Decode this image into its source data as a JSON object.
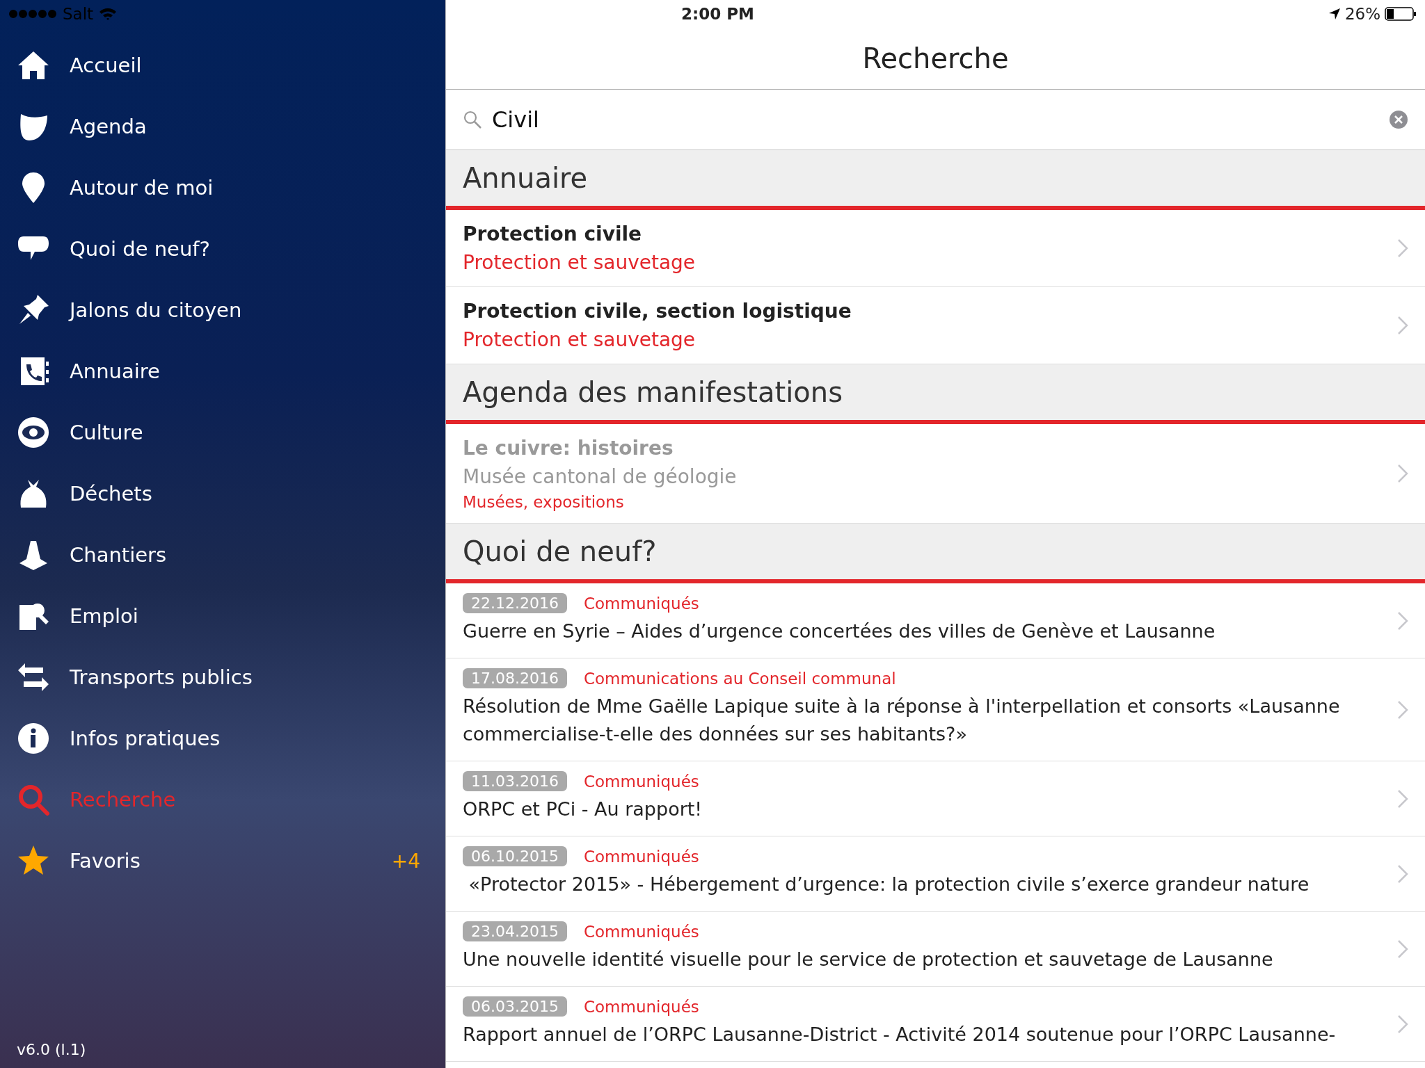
{
  "status_bar": {
    "carrier": "Salt",
    "time": "2:00 PM",
    "battery": "26%"
  },
  "sidebar": {
    "items": [
      {
        "label": "Accueil",
        "selected": false
      },
      {
        "label": "Agenda",
        "selected": false
      },
      {
        "label": "Autour de moi",
        "selected": false
      },
      {
        "label": "Quoi de neuf?",
        "selected": false
      },
      {
        "label": "Jalons du citoyen",
        "selected": false
      },
      {
        "label": "Annuaire",
        "selected": false
      },
      {
        "label": "Culture",
        "selected": false
      },
      {
        "label": "Déchets",
        "selected": false
      },
      {
        "label": "Chantiers",
        "selected": false
      },
      {
        "label": "Emploi",
        "selected": false
      },
      {
        "label": "Transports publics",
        "selected": false
      },
      {
        "label": "Infos pratiques",
        "selected": false
      },
      {
        "label": "Recherche",
        "selected": true
      },
      {
        "label": "Favoris",
        "selected": false,
        "badge": "+4"
      }
    ],
    "version": "v6.0 (l.1)"
  },
  "header": {
    "title": "Recherche"
  },
  "search": {
    "value": "Civil"
  },
  "sections": [
    {
      "title": "Annuaire",
      "kind": "directory",
      "items": [
        {
          "title": "Protection civile",
          "subtitle": "Protection et sauvetage"
        },
        {
          "title": "Protection civile, section logistique",
          "subtitle": "Protection et sauvetage"
        }
      ]
    },
    {
      "title": "Agenda des manifestations",
      "kind": "events",
      "items": [
        {
          "title": "Le cuivre: histoires",
          "subtitle": "Musée cantonal de géologie",
          "category": "Musées, expositions"
        }
      ]
    },
    {
      "title": "Quoi de neuf?",
      "kind": "news",
      "items": [
        {
          "date": "22.12.2016",
          "category": "Communiqués",
          "title": "Guerre en Syrie – Aides d’urgence concertées des villes de Genève et Lausanne"
        },
        {
          "date": "17.08.2016",
          "category": "Communications au Conseil communal",
          "title": "Résolution de Mme Gaëlle Lapique suite à la réponse à l'interpellation et consorts «Lausanne commercialise-t-elle des données sur ses habitants?»"
        },
        {
          "date": "11.03.2016",
          "category": "Communiqués",
          "title": "ORPC et PCi - Au rapport!"
        },
        {
          "date": "06.10.2015",
          "category": "Communiqués",
          "title": " «Protector 2015» - Hébergement d’urgence: la protection civile s’exerce grandeur nature"
        },
        {
          "date": "23.04.2015",
          "category": "Communiqués",
          "title": "Une nouvelle identité visuelle pour le service de protection et sauvetage de Lausanne"
        },
        {
          "date": "06.03.2015",
          "category": "Communiqués",
          "title": "Rapport annuel de l’ORPC Lausanne-District - Activité 2014 soutenue pour l’ORPC Lausanne-"
        }
      ]
    }
  ]
}
